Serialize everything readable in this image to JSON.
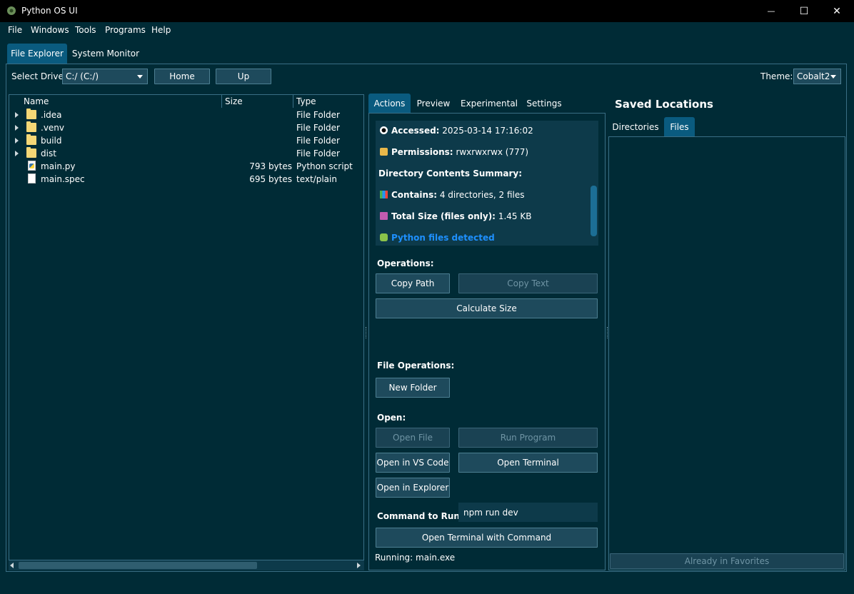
{
  "window": {
    "title": "Python OS UI",
    "minimize_glyph": "—",
    "maximize_glyph": "☐",
    "close_glyph": "✕"
  },
  "menu": {
    "file": "File",
    "windows": "Windows",
    "tools": "Tools",
    "programs": "Programs",
    "help": "Help"
  },
  "main_tabs": [
    {
      "label": "File Explorer",
      "active": true
    },
    {
      "label": "System Monitor",
      "active": false
    }
  ],
  "toolbar": {
    "drive_label": "Select Drive:",
    "drive_value": "C:/ (C:/)",
    "home_label": "Home",
    "up_label": "Up",
    "theme_label": "Theme:",
    "theme_value": "Cobalt2"
  },
  "tree": {
    "columns": [
      "Name",
      "Size",
      "Type"
    ],
    "rows": [
      {
        "name": ".idea",
        "size": "",
        "type": "File Folder",
        "kind": "folder-icon"
      },
      {
        "name": ".venv",
        "size": "",
        "type": "File Folder",
        "kind": "folder-icon"
      },
      {
        "name": "build",
        "size": "",
        "type": "File Folder",
        "kind": "folder-icon"
      },
      {
        "name": "dist",
        "size": "",
        "type": "File Folder",
        "kind": "folder-icon"
      },
      {
        "name": "main.py",
        "size": "793 bytes",
        "type": "Python script",
        "kind": "python-file-icon"
      },
      {
        "name": "main.spec",
        "size": "695 bytes",
        "type": "text/plain",
        "kind": "file-icon"
      }
    ]
  },
  "panel_tabs": [
    {
      "label": "Actions",
      "active": true
    },
    {
      "label": "Preview",
      "active": false
    },
    {
      "label": "Experimental",
      "active": false
    },
    {
      "label": "Settings",
      "active": false
    }
  ],
  "info": {
    "accessed_label": "Accessed:",
    "accessed_value": "2025-03-14 17:16:02",
    "permissions_label": "Permissions:",
    "permissions_value": "rwxrwxrwx (777)",
    "summary_heading": "Directory Contents Summary:",
    "contains_label": "Contains:",
    "contains_value": "4 directories, 2 files",
    "total_size_label": "Total Size (files only):",
    "total_size_value": "1.45 KB",
    "python_detected": "Python files detected"
  },
  "operations": {
    "heading": "Operations:",
    "copy_path": "Copy Path",
    "copy_text": "Copy Text",
    "calculate_size": "Calculate Size"
  },
  "file_operations": {
    "heading": "File Operations:",
    "new_folder": "New Folder"
  },
  "open": {
    "heading": "Open:",
    "open_file": "Open File",
    "run_program": "Run Program",
    "open_vscode": "Open in VS Code",
    "open_terminal": "Open Terminal",
    "open_explorer": "Open in Explorer"
  },
  "command": {
    "label": "Command to Run:",
    "value": "npm run dev",
    "run_button": "Open Terminal with Command",
    "status": "Running: main.exe"
  },
  "saved": {
    "title": "Saved Locations",
    "tabs": [
      {
        "label": "Directories",
        "active": false
      },
      {
        "label": "Files",
        "active": true
      }
    ],
    "favorites_button": "Already in Favorites"
  },
  "colors": {
    "background": "#002b36",
    "accent": "#0a5b7f",
    "link": "#1e90ff"
  }
}
